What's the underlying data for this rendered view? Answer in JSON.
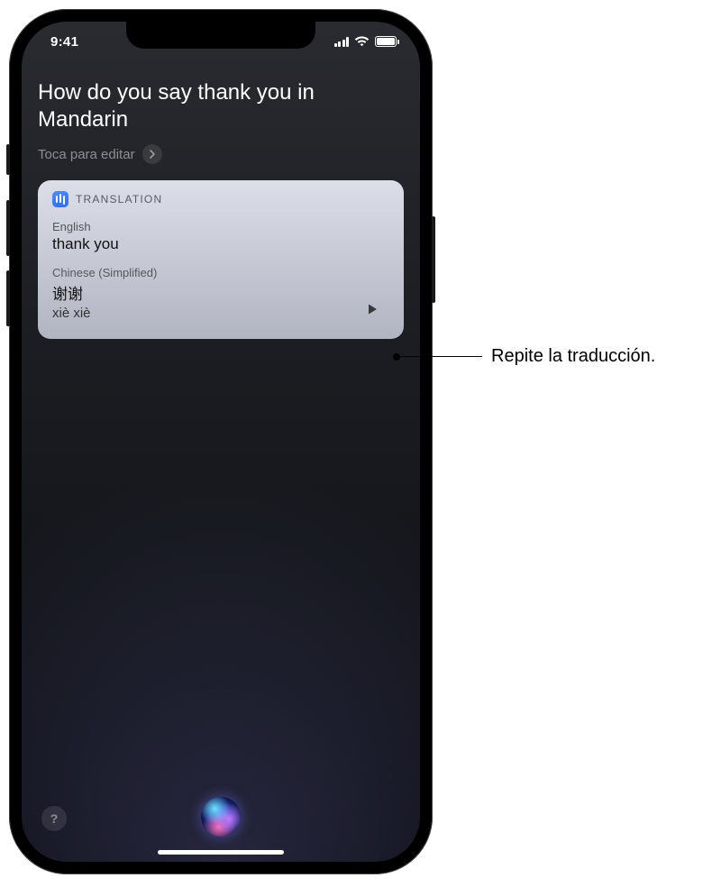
{
  "statusbar": {
    "time": "9:41"
  },
  "siri": {
    "query": "How do you say thank you in Mandarin",
    "tap_to_edit": "Toca para editar"
  },
  "card": {
    "header": "TRANSLATION",
    "source_lang": "English",
    "source_text": "thank you",
    "target_lang": "Chinese (Simplified)",
    "target_text": "谢谢",
    "pinyin": "xiè xiè"
  },
  "help": {
    "symbol": "?"
  },
  "callout": {
    "text": "Repite la traducción."
  }
}
